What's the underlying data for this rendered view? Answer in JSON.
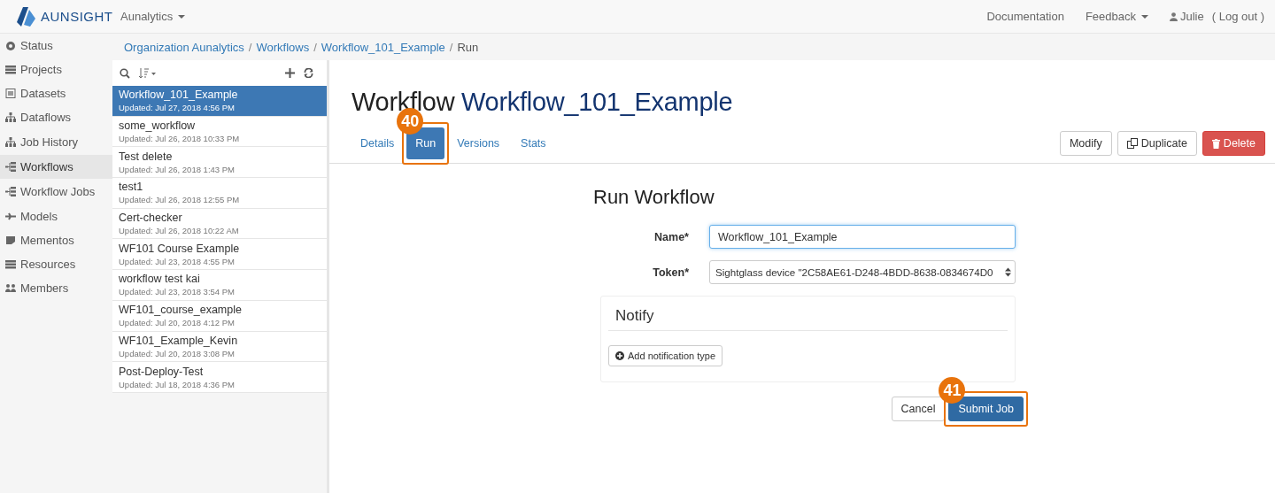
{
  "navbar": {
    "brand": "AUNSIGHT",
    "org_menu": "Aunalytics",
    "links": [
      {
        "label": "Documentation"
      },
      {
        "label": "Feedback",
        "dropdown": true
      }
    ],
    "user": "Julie",
    "logout": "( Log out )"
  },
  "sidebar": {
    "items": [
      {
        "label": "Status",
        "selected": false
      },
      {
        "label": "Projects",
        "selected": false
      },
      {
        "label": "Datasets",
        "selected": false
      },
      {
        "label": "Dataflows",
        "selected": false
      },
      {
        "label": "Job History",
        "selected": false
      },
      {
        "label": "Workflows",
        "selected": true
      },
      {
        "label": "Workflow Jobs",
        "selected": false
      },
      {
        "label": "Models",
        "selected": false
      },
      {
        "label": "Mementos",
        "selected": false
      },
      {
        "label": "Resources",
        "selected": false
      },
      {
        "label": "Members",
        "selected": false
      }
    ]
  },
  "breadcrumb": [
    {
      "label": "Organization Aunalytics",
      "link": true
    },
    {
      "separator": "/",
      "label": "Workflows",
      "link": true
    },
    {
      "separator": "/",
      "label": "Workflow_101_Example",
      "link": true
    },
    {
      "separator": "/",
      "label": "Run",
      "link": false
    }
  ],
  "workflow_list": {
    "items": [
      {
        "name": "Workflow_101_Example",
        "updated": "Updated:  Jul 27, 2018 4:56 PM",
        "selected": true
      },
      {
        "name": "some_workflow",
        "updated": "Updated:  Jul 26, 2018 10:33 PM",
        "selected": false
      },
      {
        "name": "Test delete",
        "updated": "Updated:  Jul 26, 2018 1:43 PM",
        "selected": false
      },
      {
        "name": "test1",
        "updated": "Updated:  Jul 26, 2018 12:55 PM",
        "selected": false
      },
      {
        "name": "Cert-checker",
        "updated": "Updated:  Jul 26, 2018 10:22 AM",
        "selected": false
      },
      {
        "name": "WF101 Course Example",
        "updated": "Updated:  Jul 23, 2018 4:55 PM",
        "selected": false
      },
      {
        "name": "workflow test kai",
        "updated": "Updated:  Jul 23, 2018 3:54 PM",
        "selected": false
      },
      {
        "name": "WF101_course_example",
        "updated": "Updated:  Jul 20, 2018 4:12 PM",
        "selected": false
      },
      {
        "name": "WF101_Example_Kevin",
        "updated": "Updated:  Jul 20, 2018 3:08 PM",
        "selected": false
      },
      {
        "name": "Post-Deploy-Test",
        "updated": "Updated:  Jul 18, 2018 4:36 PM",
        "selected": false
      }
    ]
  },
  "title": {
    "prefix": "Workflow",
    "name": "Workflow_101_Example"
  },
  "tabs": [
    {
      "label": "Details",
      "selected": false
    },
    {
      "label": "Run",
      "selected": true,
      "callout": "40"
    },
    {
      "label": "Versions",
      "selected": false
    },
    {
      "label": "Stats",
      "selected": false
    }
  ],
  "actions": [
    {
      "label": "Modify",
      "kind": "plain"
    },
    {
      "label": "Duplicate",
      "kind": "copy"
    },
    {
      "label": "Delete",
      "kind": "danger"
    }
  ],
  "form": {
    "heading": "Run Workflow",
    "fields": [
      {
        "label": "Name*",
        "kind": "text",
        "value": "Workflow_101_Example"
      },
      {
        "label": "Token*",
        "kind": "select",
        "value": "Sightglass device \"2C58AE61-D248-4BDD-8638-0834674D0"
      }
    ],
    "notify": {
      "heading": "Notify",
      "button": "Add notification type"
    },
    "buttons": [
      {
        "label": "Cancel",
        "kind": "default"
      },
      {
        "label": "Submit Job",
        "kind": "primary",
        "callout": "41"
      }
    ]
  }
}
